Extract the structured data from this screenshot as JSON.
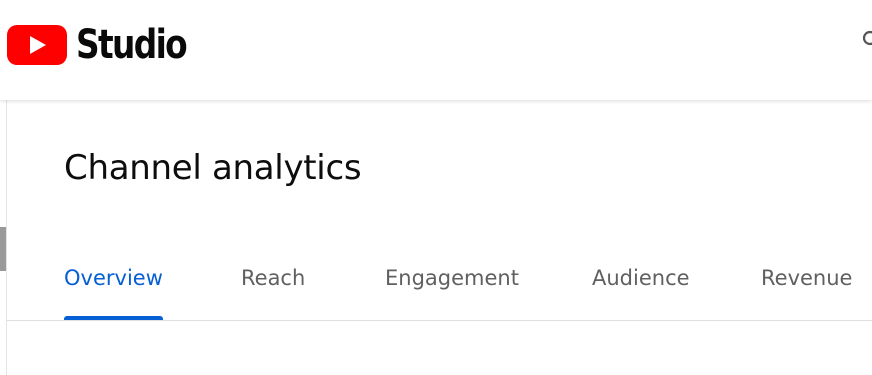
{
  "app": {
    "logo_text": "Studio",
    "brand_red": "#ff0000",
    "icons": {
      "logo": "youtube-play-icon",
      "search": "search-icon"
    }
  },
  "page": {
    "title": "Channel analytics"
  },
  "tabs": [
    {
      "label": "Overview",
      "active": true
    },
    {
      "label": "Reach",
      "active": false
    },
    {
      "label": "Engagement",
      "active": false
    },
    {
      "label": "Audience",
      "active": false
    },
    {
      "label": "Revenue",
      "active": false
    }
  ],
  "colors": {
    "accent": "#065fd4",
    "inactive_tab": "#606060",
    "title": "#0d0d0d"
  }
}
